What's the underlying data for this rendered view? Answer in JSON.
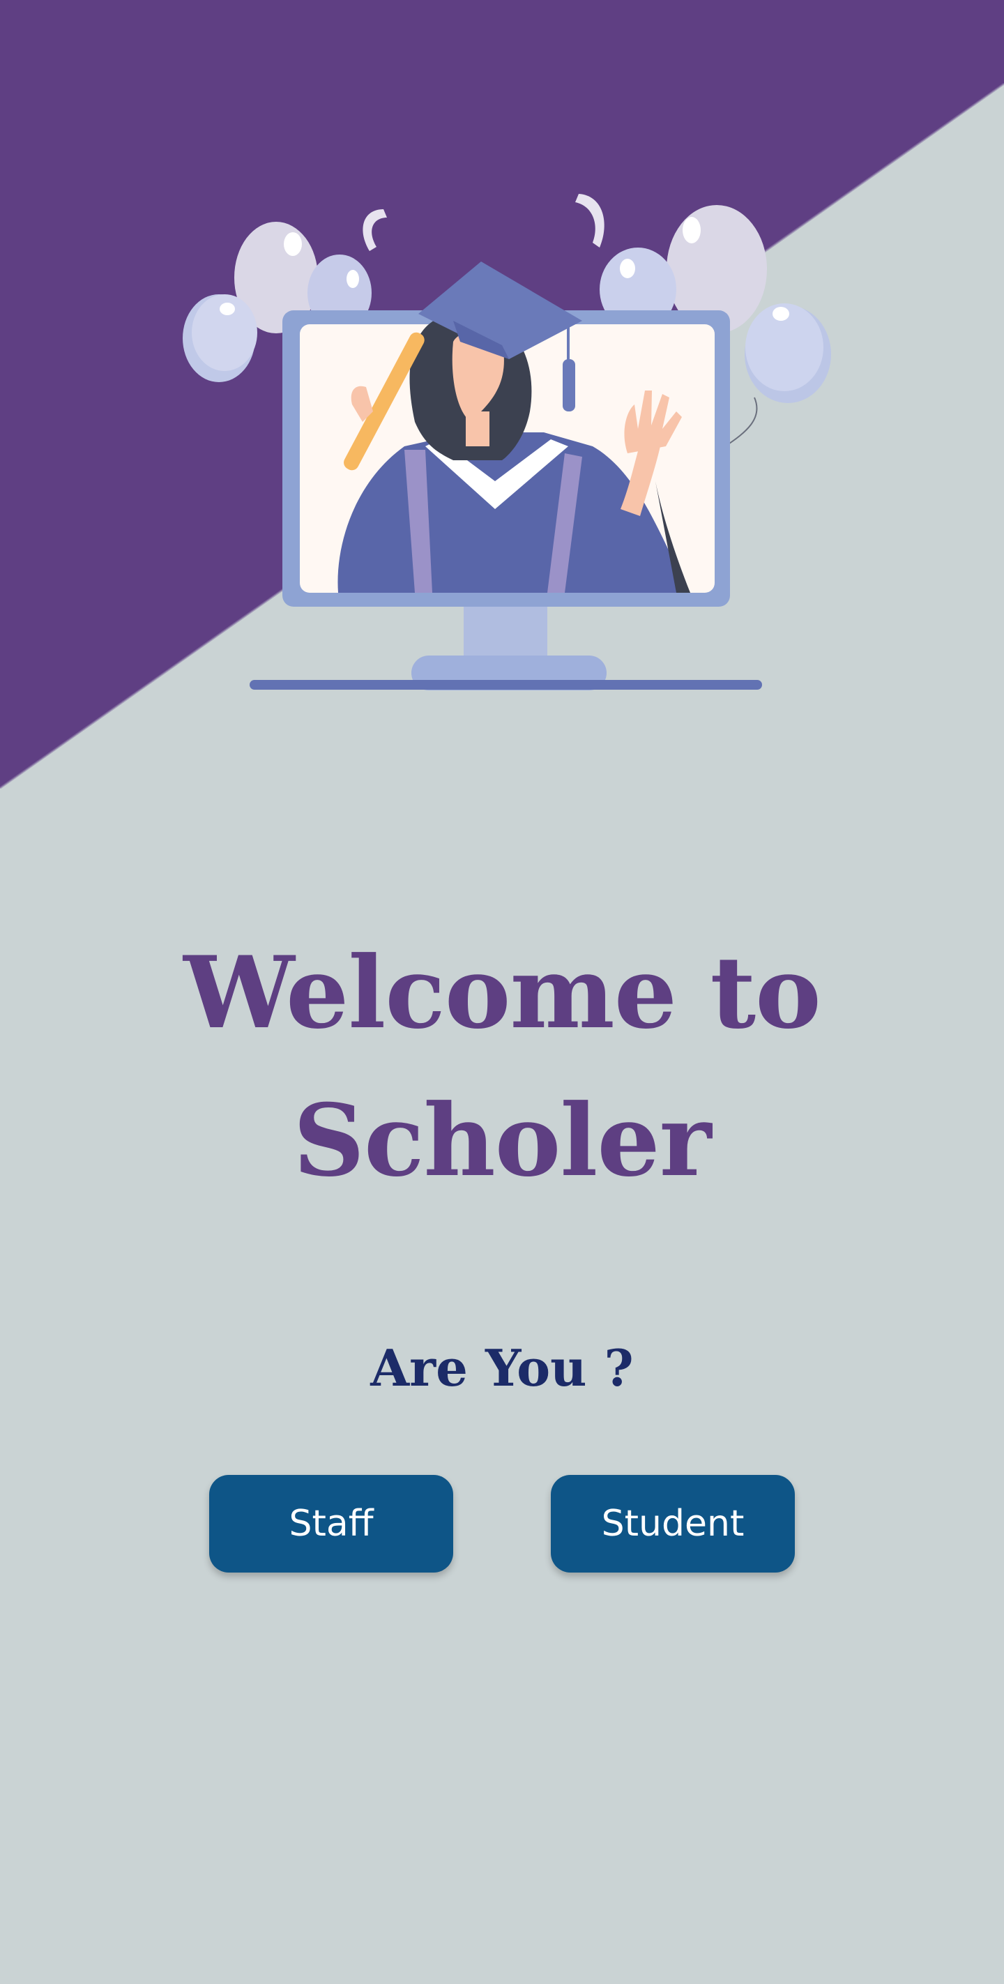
{
  "welcome": {
    "line1": "Welcome to",
    "line2": "Scholer"
  },
  "question": "Are You ?",
  "buttons": {
    "staff": "Staff",
    "student": "Student"
  },
  "colors": {
    "background": "#cad3d4",
    "diagonal_band": "#5f3f83",
    "title": "#5e3f82",
    "question": "#1c2b68",
    "button": "#0e5587",
    "button_text": "#ffffff"
  },
  "illustration": {
    "subject": "graduate-on-monitor-illustration",
    "icons": [
      "balloon-icon",
      "confetti-icon",
      "graduation-cap-icon",
      "diploma-icon",
      "monitor-icon"
    ]
  }
}
